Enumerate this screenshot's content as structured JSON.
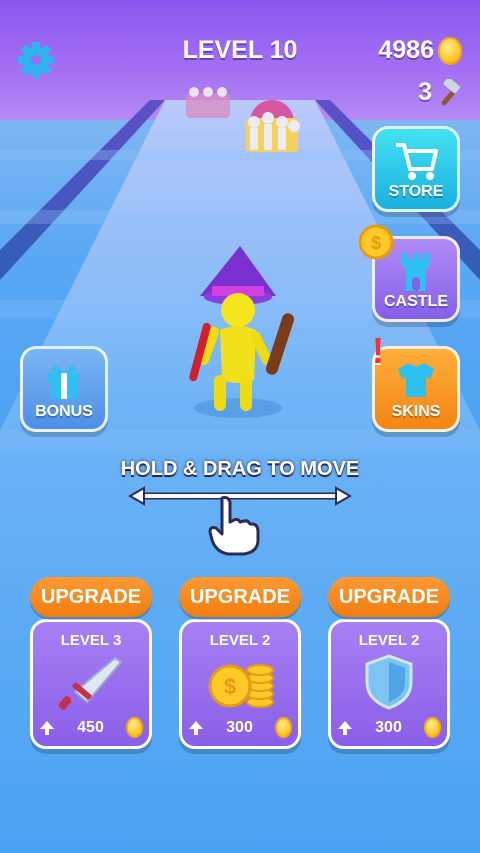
{
  "hud": {
    "level": "LEVEL 10",
    "coins": "4986",
    "hammers": "3"
  },
  "side_buttons": {
    "store": "STORE",
    "castle": "CASTLE",
    "skins": "SKINS",
    "bonus": "BONUS"
  },
  "hint": {
    "text": "HOLD & DRAG TO MOVE"
  },
  "upgrades": [
    {
      "button": "UPGRADE",
      "level": "LEVEL 3",
      "cost": "450",
      "icon": "sword-icon"
    },
    {
      "button": "UPGRADE",
      "level": "LEVEL 2",
      "cost": "300",
      "icon": "coin-stack-icon"
    },
    {
      "button": "UPGRADE",
      "level": "LEVEL 2",
      "cost": "300",
      "icon": "shield-icon"
    }
  ],
  "colors": {
    "accent_orange": "#f58512",
    "store_cyan": "#1ab0e0",
    "castle_purple": "#8560e8",
    "card_purple": "#8a5fe8",
    "coin_gold": "#ffc928"
  }
}
